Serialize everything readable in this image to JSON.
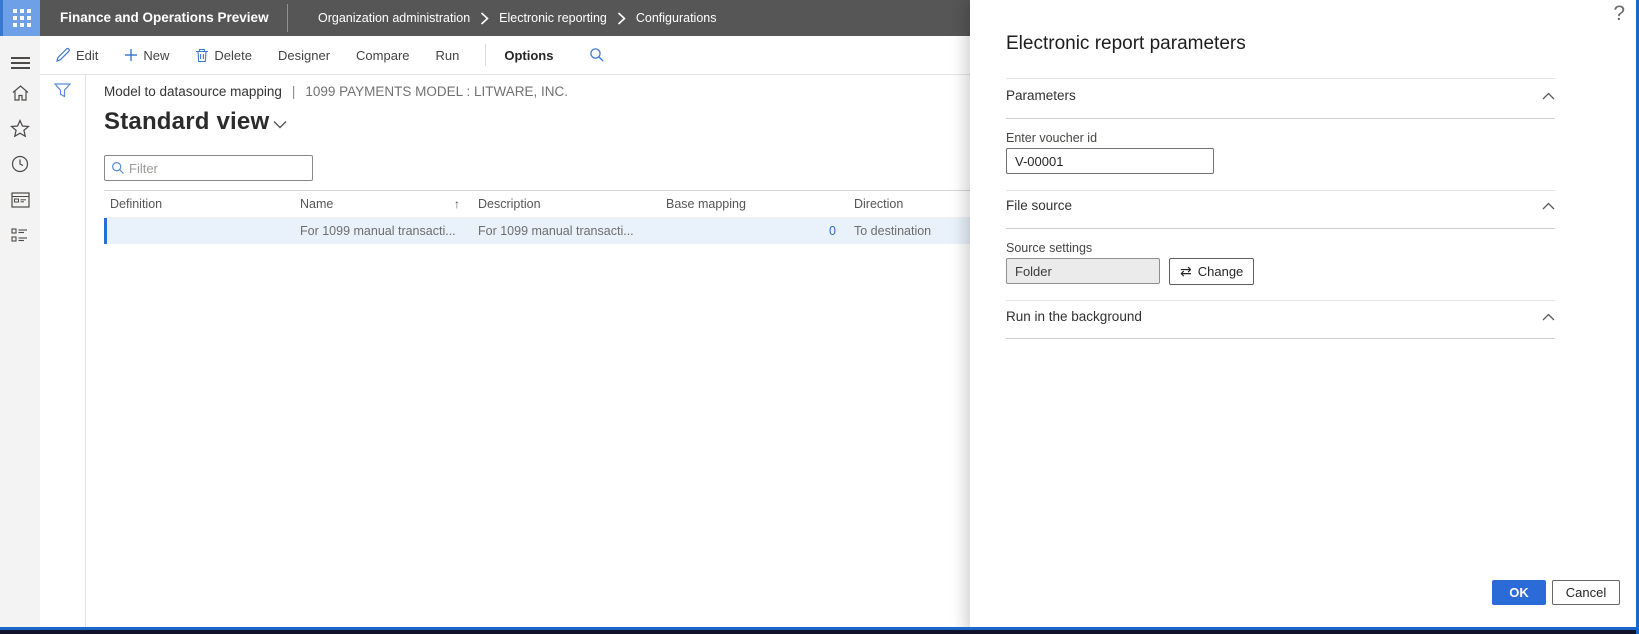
{
  "app": {
    "title": "Finance and Operations Preview",
    "breadcrumb": [
      "Organization administration",
      "Electronic reporting",
      "Configurations"
    ],
    "help_glyph": "?"
  },
  "action_bar": {
    "edit": "Edit",
    "new": "New",
    "delete": "Delete",
    "designer": "Designer",
    "compare": "Compare",
    "run": "Run",
    "options": "Options"
  },
  "content": {
    "caption": "Model to datasource mapping",
    "caption_separator": "|",
    "caption_detail": "1099 PAYMENTS MODEL : LITWARE, INC.",
    "view_title": "Standard view",
    "filter_placeholder": "Filter"
  },
  "table": {
    "columns": [
      "Definition",
      "Name",
      "Description",
      "Base mapping",
      "Direction"
    ],
    "sort_indicator": "↑",
    "rows": [
      {
        "definition": "",
        "name": "For 1099 manual transacti...",
        "description": "For 1099 manual transacti...",
        "base_mapping": "0",
        "direction": "To destination"
      }
    ]
  },
  "panel": {
    "title": "Electronic report parameters",
    "sections": {
      "parameters": "Parameters",
      "file_source": "File source",
      "run_background": "Run in the background"
    },
    "voucher_label": "Enter voucher id",
    "voucher_value": "V-00001",
    "source_settings_label": "Source settings",
    "source_settings_value": "Folder",
    "change_label": "Change",
    "swap_glyph": "⇄",
    "ok_label": "OK",
    "cancel_label": "Cancel"
  },
  "colors": {
    "accent_blue": "#2b6bd7",
    "topbar_gray": "#565656",
    "launcher_blue": "#6ea0e8",
    "selected_row": "#e9f1fb"
  }
}
